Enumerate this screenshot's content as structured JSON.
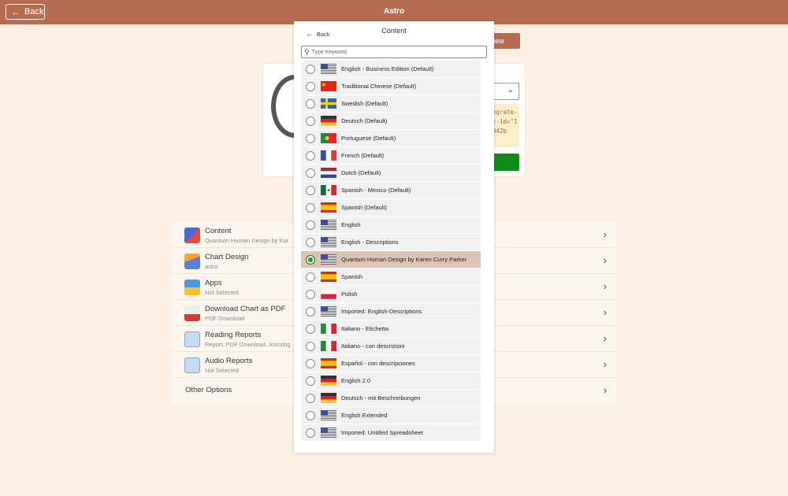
{
  "header": {
    "back_label": "Back",
    "title": "Astro"
  },
  "background": {
    "preview_label": "view",
    "code_lines": [
      "egrate-",
      "t-id=\"1",
      "942b"
    ],
    "settings": [
      {
        "title": "Content",
        "subtitle": "Quantum Human Design by Kar",
        "icon": "content-icon"
      },
      {
        "title": "Chart Design",
        "subtitle": "astro",
        "icon": "chart-design-icon"
      },
      {
        "title": "Apps",
        "subtitle": "Not Selected",
        "icon": "apps-icon"
      },
      {
        "title": "Download Chart as PDF",
        "subtitle": "PDF Download",
        "icon": "pdf-icon"
      },
      {
        "title": "Reading Reports",
        "subtitle": "Report, PDF Download, Astrolog",
        "icon": "report-icon"
      },
      {
        "title": "Audio Reports",
        "subtitle": "Not Selected",
        "icon": "audio-report-icon"
      },
      {
        "title": "Other Options"
      }
    ]
  },
  "modal": {
    "back_label": "Back",
    "title": "Content",
    "search_placeholder": "Type Keyword",
    "items": [
      {
        "label": "English - Business Edition (Default)",
        "flag": "us",
        "selected": false
      },
      {
        "label": "Traditional Chinese (Default)",
        "flag": "cn",
        "selected": false
      },
      {
        "label": "Swedish (Default)",
        "flag": "se",
        "selected": false
      },
      {
        "label": "Deutsch (Default)",
        "flag": "de",
        "selected": false
      },
      {
        "label": "Portuguese (Default)",
        "flag": "pt",
        "selected": false
      },
      {
        "label": "French (Default)",
        "flag": "fr",
        "selected": false
      },
      {
        "label": "Dutch (Default)",
        "flag": "nl",
        "selected": false
      },
      {
        "label": "Spanish - Mexico (Default)",
        "flag": "mx",
        "selected": false
      },
      {
        "label": "Spanish (Default)",
        "flag": "es",
        "selected": false
      },
      {
        "label": "English",
        "flag": "us",
        "selected": false
      },
      {
        "label": "English - Descriptions",
        "flag": "us",
        "selected": false
      },
      {
        "label": "Quantum Human Design by Karen Curry Parker",
        "flag": "us",
        "selected": true
      },
      {
        "label": "Spanish",
        "flag": "es",
        "selected": false
      },
      {
        "label": "Polish",
        "flag": "pl",
        "selected": false
      },
      {
        "label": "Imported: English-Descriptions",
        "flag": "us",
        "selected": false
      },
      {
        "label": "Italiano - Etichetta",
        "flag": "it",
        "selected": false
      },
      {
        "label": "Italiano - con descrizioni",
        "flag": "it",
        "selected": false
      },
      {
        "label": "Español - con descripciones",
        "flag": "es",
        "selected": false
      },
      {
        "label": "English 2.0",
        "flag": "de",
        "selected": false
      },
      {
        "label": "Deutsch - mit Beschreibungen",
        "flag": "de",
        "selected": false
      },
      {
        "label": "English Extended",
        "flag": "us",
        "selected": false
      },
      {
        "label": "Imported: Untitled Spreadsheet",
        "flag": "us",
        "selected": false
      }
    ]
  },
  "colors": {
    "header": "#b56c53",
    "page": "#fcefe3",
    "selected_row": "#dcc5b8",
    "radio_on": "#149a22",
    "primary_green": "#12891b"
  }
}
